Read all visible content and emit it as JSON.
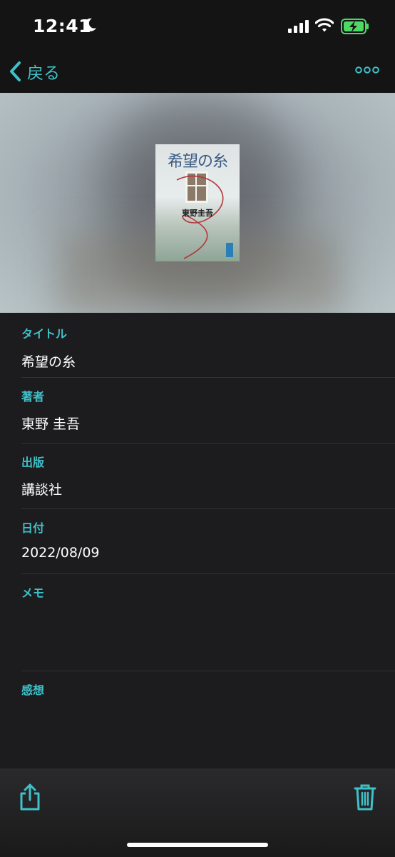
{
  "status_bar": {
    "time": "12:41",
    "icons": [
      "moon-icon",
      "cellular-signal-icon",
      "wifi-icon",
      "battery-charging-icon"
    ]
  },
  "nav": {
    "back_label": "戻る",
    "more_icon": "ellipsis-icon"
  },
  "cover": {
    "title": "希望の糸",
    "author": "東野圭吾"
  },
  "fields": [
    {
      "label": "タイトル",
      "value": "希望の糸"
    },
    {
      "label": "著者",
      "value": "東野 圭吾"
    },
    {
      "label": "出版",
      "value": "講談社"
    },
    {
      "label": "日付",
      "value": "2022/08/09"
    },
    {
      "label": "メモ",
      "value": ""
    },
    {
      "label": "感想",
      "value": ""
    }
  ],
  "toolbar": {
    "share_icon": "share-icon",
    "trash_icon": "trash-icon"
  },
  "colors": {
    "accent": "#3fc1c9",
    "background": "#1c1c1e",
    "bar_background": "#141414",
    "battery": "#4cd964"
  }
}
